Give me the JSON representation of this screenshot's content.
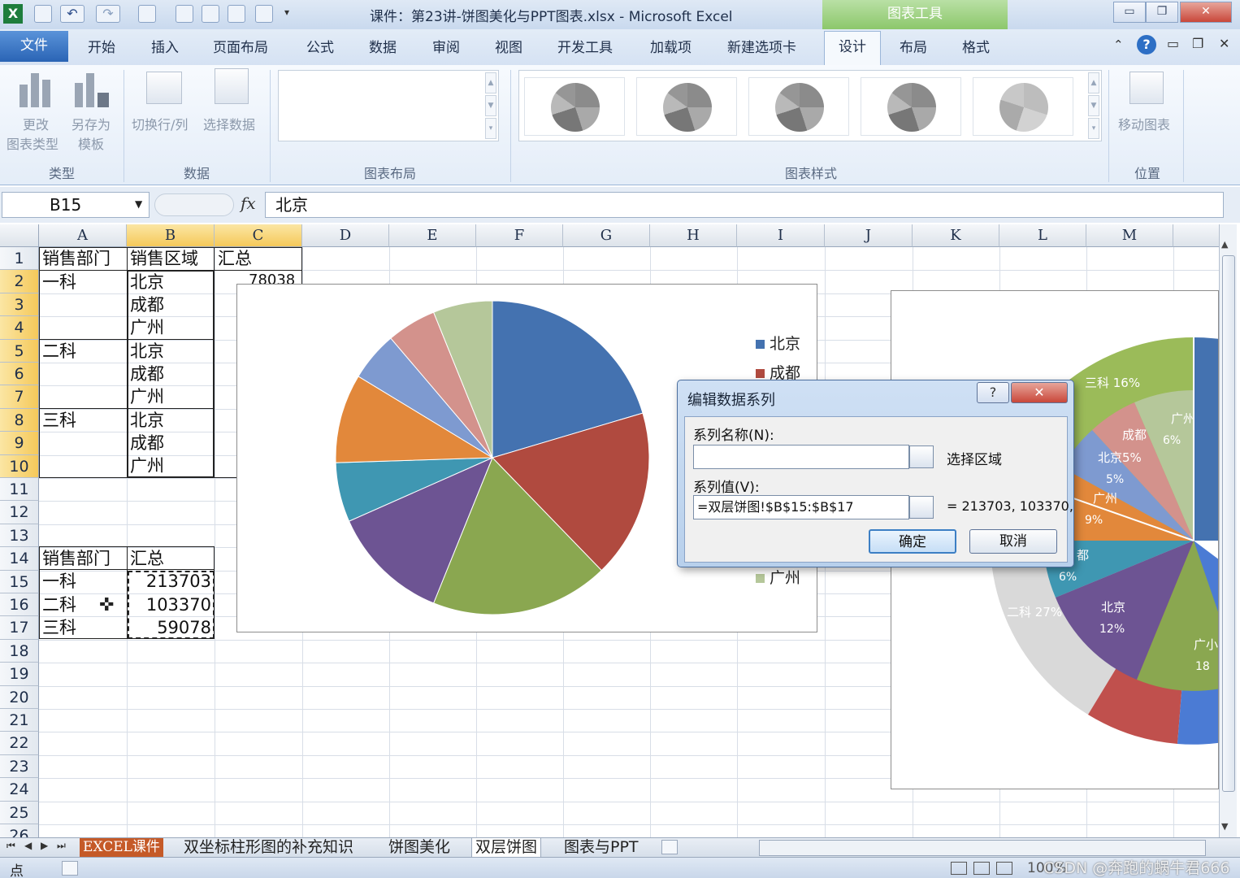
{
  "window": {
    "title": "课件：第23讲-饼图美化与PPT图表.xlsx - Microsoft Excel",
    "context_tab": "图表工具"
  },
  "tabs": [
    "文件",
    "开始",
    "插入",
    "页面布局",
    "公式",
    "数据",
    "审阅",
    "视图",
    "开发工具",
    "加载项",
    "新建选项卡",
    "设计",
    "布局",
    "格式"
  ],
  "active_tab": "设计",
  "ribbon": {
    "change_type_l1": "更改",
    "change_type_l2": "图表类型",
    "save_template_l1": "另存为",
    "save_template_l2": "模板",
    "switch_row_col": "切换行/列",
    "select_data": "选择数据",
    "move_chart": "移动图表",
    "groups": {
      "type": "类型",
      "data": "数据",
      "layout": "图表布局",
      "styles": "图表样式",
      "location": "位置"
    }
  },
  "formula_bar": {
    "name_box": "B15",
    "fx": "fx",
    "content": "北京"
  },
  "columns": [
    "A",
    "B",
    "C",
    "D",
    "E",
    "F",
    "G",
    "H",
    "I",
    "J",
    "K",
    "L",
    "M"
  ],
  "rows": [
    "1",
    "2",
    "3",
    "4",
    "5",
    "6",
    "7",
    "8",
    "9",
    "10",
    "11",
    "12",
    "13",
    "14",
    "15",
    "16",
    "17",
    "18",
    "19",
    "20",
    "21",
    "22",
    "23",
    "24",
    "25",
    "26"
  ],
  "table1": {
    "headers": [
      "销售部门",
      "销售区域",
      "汇总"
    ],
    "departments": [
      "一科",
      "二科",
      "三科"
    ],
    "regions": [
      "北京",
      "成都",
      "广州",
      "北京",
      "成都",
      "广州",
      "北京",
      "成都",
      "广州"
    ],
    "c2_partial": "78038"
  },
  "table2": {
    "headers": [
      "销售部门",
      "汇总"
    ],
    "rows": [
      {
        "dept": "一科",
        "total": "213703"
      },
      {
        "dept": "二科",
        "total": "103370"
      },
      {
        "dept": "三科",
        "total": "59078"
      }
    ]
  },
  "chart1_legend": [
    "北京",
    "成都",
    "广州"
  ],
  "chart2_labels": [
    {
      "text": "三科 16%"
    },
    {
      "text": "广州"
    },
    {
      "text": "6%"
    },
    {
      "text": "成都"
    },
    {
      "text": "北京5%"
    },
    {
      "text": "5%"
    },
    {
      "text": "广州"
    },
    {
      "text": "9%"
    },
    {
      "text": "都"
    },
    {
      "text": "6%"
    },
    {
      "text": "二科 27%"
    },
    {
      "text": "北京"
    },
    {
      "text": "12%"
    },
    {
      "text": "广小"
    },
    {
      "text": "18"
    }
  ],
  "dialog": {
    "title": "编辑数据系列",
    "help": "?",
    "close": "✕",
    "series_name_label": "系列名称(N):",
    "series_name_value": "",
    "select_range": "选择区域",
    "series_values_label": "系列值(V):",
    "series_values_value": "=双层饼图!$B$15:$B$17",
    "preview": "= 213703, 103370,",
    "ok": "确定",
    "cancel": "取消"
  },
  "sheet_tabs": [
    "EXCEL课件",
    "双坐标柱形图的补充知识",
    "饼图美化",
    "双层饼图",
    "图表与PPT"
  ],
  "active_sheet": "双层饼图",
  "status": {
    "mode": "点",
    "zoom": "100%",
    "watermark": "CSDN @奔跑的蜗牛君666"
  },
  "chart_data": [
    {
      "type": "pie",
      "title": "",
      "slices": [
        {
          "label": "北京",
          "value": 20,
          "color": "#4472b0"
        },
        {
          "label": "成都",
          "value": 17,
          "color": "#b04a3f"
        },
        {
          "label": "广州",
          "value": 18,
          "color": "#8aa750"
        },
        {
          "label": "北京",
          "value": 12,
          "color": "#6d5493"
        },
        {
          "label": "成都",
          "value": 6,
          "color": "#3f97b2"
        },
        {
          "label": "广州",
          "value": 9,
          "color": "#e2883b"
        },
        {
          "label": "北京",
          "value": 5,
          "color": "#7e9ad0"
        },
        {
          "label": "成都",
          "value": 5,
          "color": "#d3928c"
        },
        {
          "label": "广州",
          "value": 6,
          "color": "#b5c79a"
        }
      ]
    }
  ],
  "colors": {
    "accent_green": "#8cc76b",
    "file_tab": "#2a64b5",
    "selection": "#f5c95a"
  }
}
